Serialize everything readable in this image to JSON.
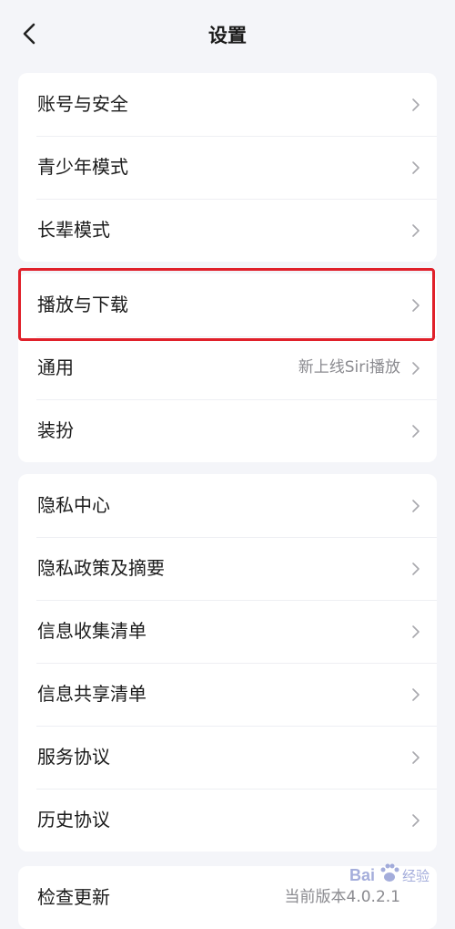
{
  "header": {
    "title": "设置"
  },
  "group1": {
    "items": [
      {
        "label": "账号与安全"
      },
      {
        "label": "青少年模式"
      },
      {
        "label": "长辈模式"
      }
    ]
  },
  "group2": {
    "items": [
      {
        "label": "播放与下载"
      },
      {
        "label": "通用",
        "note": "新上线Siri播放"
      },
      {
        "label": "装扮"
      }
    ]
  },
  "group3": {
    "items": [
      {
        "label": "隐私中心"
      },
      {
        "label": "隐私政策及摘要"
      },
      {
        "label": "信息收集清单"
      },
      {
        "label": "信息共享清单"
      },
      {
        "label": "服务协议"
      },
      {
        "label": "历史协议"
      }
    ]
  },
  "group4": {
    "items": [
      {
        "label": "检查更新",
        "note": "当前版本4.0.2.1"
      }
    ]
  },
  "watermark": {
    "text": "Bai 经验",
    "icon": "baidu-paw-icon"
  },
  "colors": {
    "background": "#f4f5f9",
    "card": "#ffffff",
    "text": "#1b1b1b",
    "secondary_text": "#8a8a8f",
    "highlight": "#e0202a"
  }
}
